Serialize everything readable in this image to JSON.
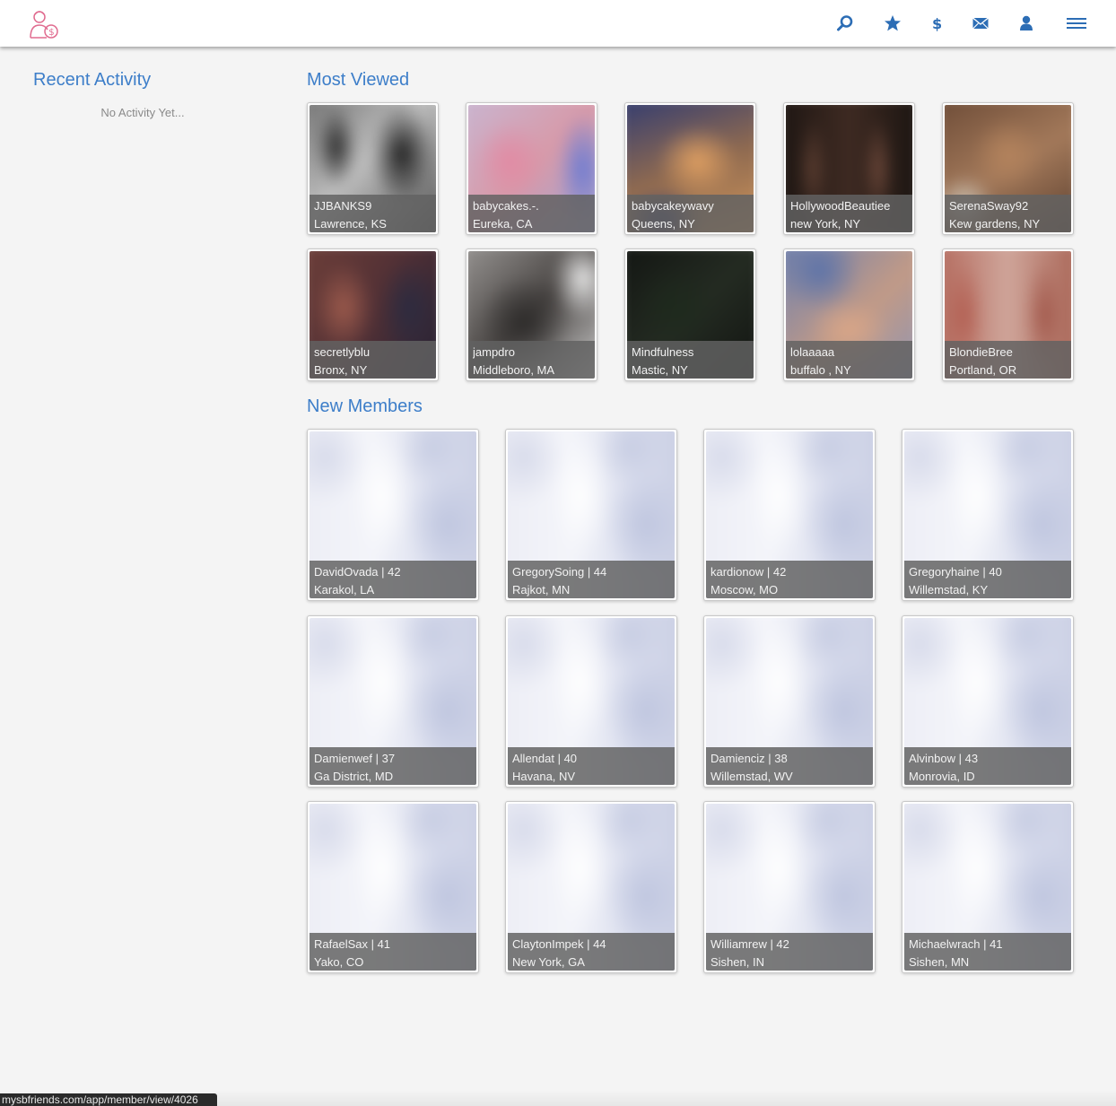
{
  "header": {
    "icons": [
      "search-icon",
      "star-icon",
      "dollar-icon",
      "mail-icon",
      "user-icon",
      "menu-icon"
    ],
    "accent_color": "#2c6db5",
    "logo_color": "#e06b8f"
  },
  "sidebar": {
    "title": "Recent Activity",
    "empty_text": "No Activity Yet..."
  },
  "most_viewed": {
    "title": "Most Viewed",
    "members": [
      {
        "name": "JJBANKS9",
        "location": "Lawrence, KS"
      },
      {
        "name": "babycakes.-.",
        "location": "Eureka, CA"
      },
      {
        "name": "babycakeywavy",
        "location": "Queens, NY"
      },
      {
        "name": "HollywoodBeautiee",
        "location": "new York, NY"
      },
      {
        "name": "SerenaSway92",
        "location": "Kew gardens, NY"
      },
      {
        "name": "secretlyblu",
        "location": "Bronx, NY"
      },
      {
        "name": "jampdro",
        "location": "Middleboro, MA"
      },
      {
        "name": "Mindfulness",
        "location": "Mastic, NY"
      },
      {
        "name": "lolaaaaa",
        "location": "buffalo , NY"
      },
      {
        "name": "BlondieBree",
        "location": "Portland, OR"
      }
    ]
  },
  "new_members": {
    "title": "New Members",
    "members": [
      {
        "name": "DavidOvada | 42",
        "location": "Karakol, LA"
      },
      {
        "name": "GregorySoing | 44",
        "location": "Rajkot, MN"
      },
      {
        "name": "kardionow | 42",
        "location": "Moscow, MO"
      },
      {
        "name": "Gregoryhaine | 40",
        "location": "Willemstad, KY"
      },
      {
        "name": "Damienwef | 37",
        "location": "Ga District, MD"
      },
      {
        "name": "Allendat | 40",
        "location": "Havana, NV"
      },
      {
        "name": "Damienciz | 38",
        "location": "Willemstad, WV"
      },
      {
        "name": "Alvinbow | 43",
        "location": "Monrovia, ID"
      },
      {
        "name": "RafaelSax | 41",
        "location": "Yako, CO"
      },
      {
        "name": "ClaytonImpek | 44",
        "location": "New York, GA"
      },
      {
        "name": "Williamrew | 42",
        "location": "Sishen, IN"
      },
      {
        "name": "Michaelwrach | 41",
        "location": "Sishen, MN"
      }
    ]
  },
  "status_bar": {
    "url": "mysbfriends.com/app/member/view/4026"
  }
}
